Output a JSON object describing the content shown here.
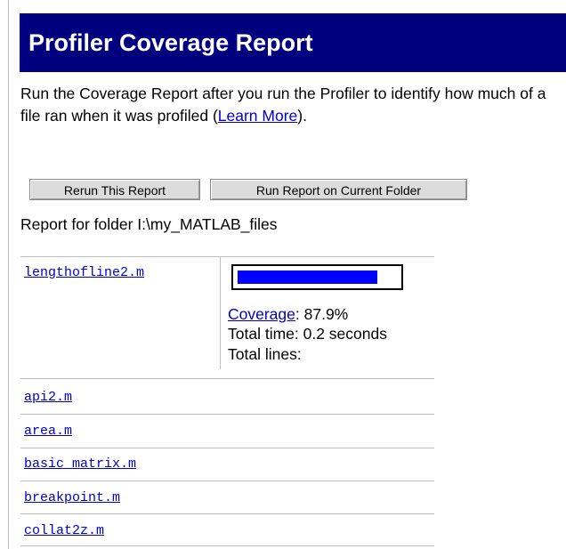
{
  "report": {
    "title": "Profiler Coverage Report",
    "description_prefix": "Run the Coverage Report after you run the Profiler to identify how much of a file ran when it was profiled (",
    "learn_more_link": "Learn More",
    "description_suffix": ").",
    "buttons": {
      "rerun_label": "Rerun This Report",
      "run_folder_label": "Run Report on Current Folder"
    },
    "folder_line": "Report for folder I:\\my_MATLAB_files"
  },
  "files": [
    {
      "name": "lengthofline2.m",
      "coverage_fraction": 0.879,
      "coverage_link": "Coverage",
      "coverage_value": ": 87.9%",
      "total_time": "Total time: 0.2 seconds",
      "total_lines": "Total lines:"
    },
    {
      "name": "api2.m"
    },
    {
      "name": "area.m"
    },
    {
      "name": "basic_matrix.m"
    },
    {
      "name": "breakpoint.m"
    },
    {
      "name": "collat2z.m"
    }
  ],
  "colors": {
    "title_bg": "#00007f",
    "link": "#0000cc",
    "coverage_bar": "#0000ff"
  }
}
